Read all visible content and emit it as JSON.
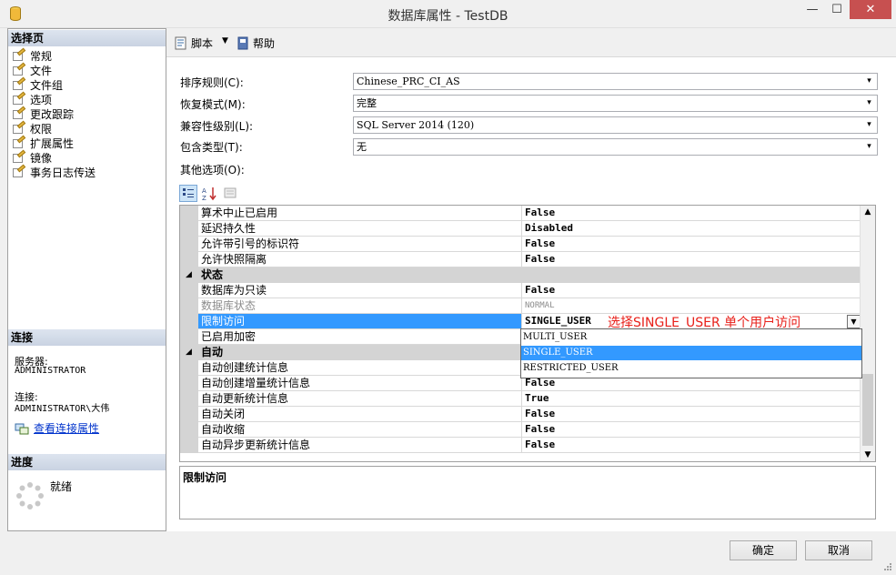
{
  "window": {
    "title": "数据库属性 - TestDB",
    "minimize": "—",
    "maximize": "☐",
    "close": "✕"
  },
  "left": {
    "select_page_header": "选择页",
    "pages": [
      "常规",
      "文件",
      "文件组",
      "选项",
      "更改跟踪",
      "权限",
      "扩展属性",
      "镜像",
      "事务日志传送"
    ],
    "connection_header": "连接",
    "server_label": "服务器:",
    "server_value": "ADMINISTRATOR",
    "connection_label": "连接:",
    "connection_value": "ADMINISTRATOR\\大伟",
    "view_conn_props": "查看连接属性",
    "progress_header": "进度",
    "status": "就绪"
  },
  "toolbar": {
    "script": "脚本",
    "dropdown": "▼",
    "help": "帮助"
  },
  "props": {
    "collation_label": "排序规则(C):",
    "collation_value": "Chinese_PRC_CI_AS",
    "recovery_label": "恢复模式(M):",
    "recovery_value": "完整",
    "compat_label": "兼容性级别(L):",
    "compat_value": "SQL Server 2014 (120)",
    "contain_label": "包含类型(T):",
    "contain_value": "无",
    "other_label": "其他选项(O):",
    "combo_arrow": "▾"
  },
  "grid": {
    "rows": [
      {
        "name": "算术中止已启用",
        "value": "False"
      },
      {
        "name": "延迟持久性",
        "value": "Disabled"
      },
      {
        "name": "允许带引号的标识符",
        "value": "False"
      },
      {
        "name": "允许快照隔离",
        "value": "False"
      },
      {
        "category": "状态",
        "toggle": "◢"
      },
      {
        "name": "数据库为只读",
        "value": "False"
      },
      {
        "name": "数据库状态",
        "value": "NORMAL"
      },
      {
        "name": "限制访问",
        "value": "SINGLE_USER"
      },
      {
        "name": "已启用加密",
        "value": ""
      },
      {
        "category": "自动",
        "toggle": "◢"
      },
      {
        "name": "自动创建统计信息",
        "value": ""
      },
      {
        "name": "自动创建增量统计信息",
        "value": "False"
      },
      {
        "name": "自动更新统计信息",
        "value": "True"
      },
      {
        "name": "自动关闭",
        "value": "False"
      },
      {
        "name": "自动收缩",
        "value": "False"
      },
      {
        "name": "自动异步更新统计信息",
        "value": "False"
      }
    ],
    "dropdown_options": [
      "MULTI_USER",
      "SINGLE_USER",
      "RESTRICTED_USER"
    ],
    "annotation": "选择SINGLE_USER 单个用户访问",
    "dropdown_arrow": "▼",
    "scroll_up": "▲",
    "scroll_down": "▼"
  },
  "description": {
    "title": "限制访问"
  },
  "buttons": {
    "ok": "确定",
    "cancel": "取消"
  },
  "colors": {
    "selection": "#3399ff",
    "annotation": "#e8201a",
    "link": "#0033cc"
  }
}
